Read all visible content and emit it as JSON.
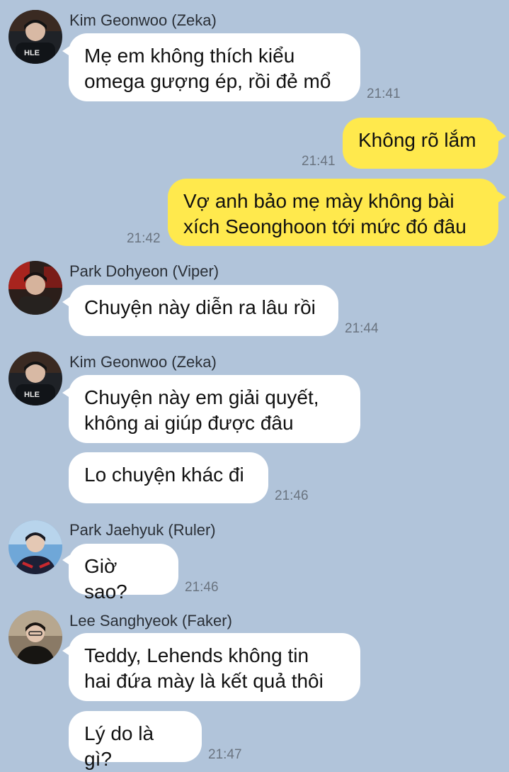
{
  "chat": {
    "messages": [
      {
        "sender": "Kim Geonwoo (Zeka)",
        "text": "Mẹ em không thích kiểu\nomega gượng ép, rồi đẻ mổ",
        "time": "21:41"
      },
      {
        "text": "Không rõ lắm",
        "time": "21:41",
        "outgoing": true
      },
      {
        "text": "Vợ anh bảo mẹ mày không bài\nxích Seonghoon tới mức đó đâu",
        "time": "21:42",
        "outgoing": true
      },
      {
        "sender": "Park Dohyeon (Viper)",
        "text": "Chuyện này diễn ra lâu rồi",
        "time": "21:44"
      },
      {
        "sender": "Kim Geonwoo (Zeka)",
        "text": "Chuyện này em giải quyết,\nkhông ai giúp được đâu"
      },
      {
        "text": "Lo chuyện khác đi",
        "time": "21:46"
      },
      {
        "sender": "Park Jaehyuk (Ruler)",
        "text": "Giờ sao?",
        "time": "21:46"
      },
      {
        "sender": "Lee Sanghyeok (Faker)",
        "text": "Teddy, Lehends không tin\nhai đứa mày là kết quả thôi"
      },
      {
        "text": "Lý do là gì?",
        "time": "21:47"
      }
    ]
  },
  "colors": {
    "background": "#b1c4da",
    "incoming_bubble": "#ffffff",
    "outgoing_bubble": "#ffe94d"
  }
}
